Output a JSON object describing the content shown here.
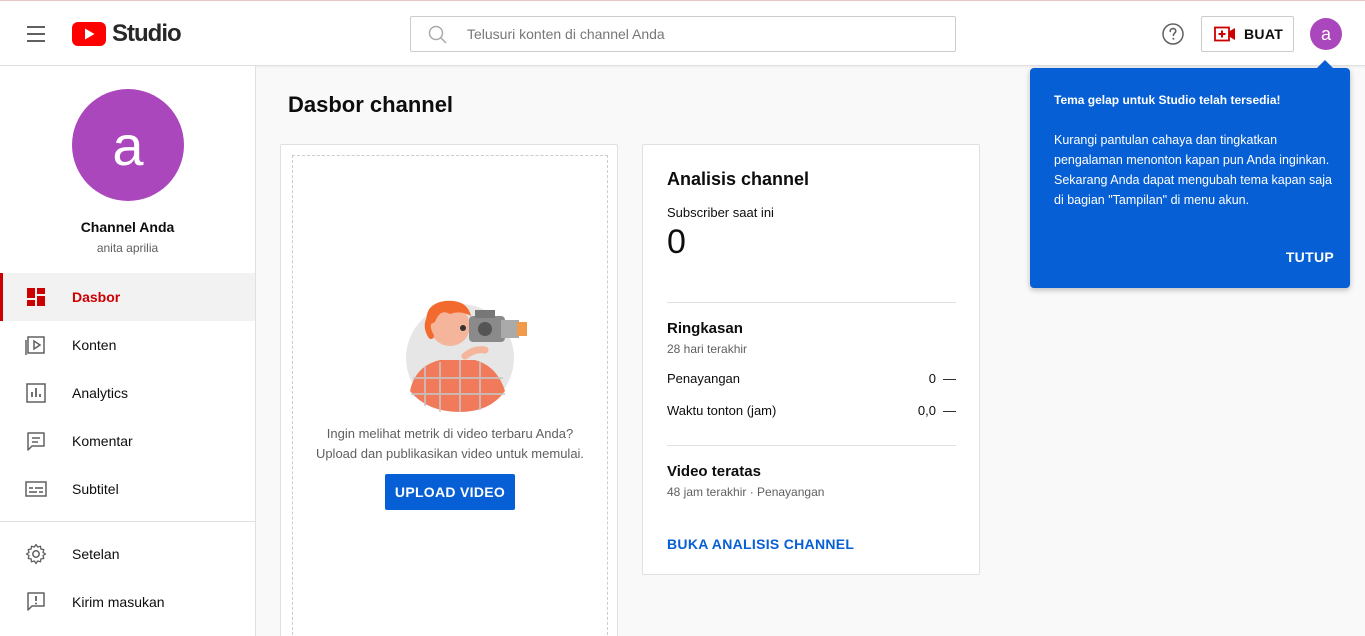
{
  "header": {
    "menu_icon": "hamburger-icon",
    "logo_text": "Studio",
    "search": {
      "placeholder": "Telusuri konten di channel Anda",
      "value": ""
    },
    "help_icon": "help-icon",
    "create_label": "BUAT",
    "avatar_letter": "a"
  },
  "sidebar": {
    "avatar_letter": "a",
    "channel_title": "Channel Anda",
    "channel_name": "anita aprilia",
    "items": [
      {
        "label": "Dasbor",
        "icon": "dashboard-icon",
        "active": true
      },
      {
        "label": "Konten",
        "icon": "content-icon"
      },
      {
        "label": "Analytics",
        "icon": "analytics-icon"
      },
      {
        "label": "Komentar",
        "icon": "comments-icon"
      },
      {
        "label": "Subtitel",
        "icon": "subtitles-icon"
      }
    ],
    "bottom_items": [
      {
        "label": "Setelan",
        "icon": "gear-icon"
      },
      {
        "label": "Kirim masukan",
        "icon": "feedback-icon"
      }
    ]
  },
  "main": {
    "page_title": "Dasbor channel",
    "upload_card": {
      "text_line1": "Ingin melihat metrik di video terbaru Anda?",
      "text_line2": "Upload dan publikasikan video untuk memulai.",
      "button_label": "UPLOAD VIDEO"
    },
    "analytics_card": {
      "title": "Analisis channel",
      "subscriber_label": "Subscriber saat ini",
      "subscriber_count": "0",
      "summary_title": "Ringkasan",
      "summary_period": "28 hari terakhir",
      "rows": [
        {
          "label": "Penayangan",
          "value": "0",
          "trend": "—"
        },
        {
          "label": "Waktu tonton (jam)",
          "value": "0,0",
          "trend": "—"
        }
      ],
      "top_videos_title": "Video teratas",
      "top_videos_period": "48 jam terakhir · Penayangan",
      "link_label": "BUKA ANALISIS CHANNEL"
    }
  },
  "tooltip": {
    "title": "Tema gelap untuk Studio telah tersedia!",
    "body": "Kurangi pantulan cahaya dan tingkatkan pengalaman menonton kapan pun Anda inginkan. Sekarang Anda dapat mengubah tema kapan saja di bagian \"Tampilan\" di menu akun.",
    "close_label": "TUTUP"
  },
  "colors": {
    "accent_blue": "#065fd4",
    "brand_red": "#ff0000",
    "active_red": "#cc0000",
    "avatar_purple": "#ab47bc"
  }
}
